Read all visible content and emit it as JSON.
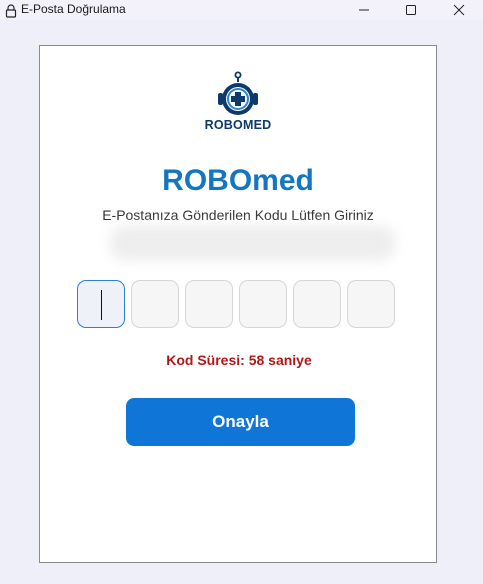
{
  "window": {
    "title": "E-Posta Doğrulama",
    "controls": [
      "minimize",
      "maximize",
      "close"
    ]
  },
  "logo": {
    "text": "ROBOMED",
    "icon": "robot-medical-cross-icon"
  },
  "app_name": "ROBOmed",
  "subtitle": "E-Postanıza Gönderilen Kodu Lütfen Giriniz",
  "code_inputs": [
    "",
    "",
    "",
    "",
    "",
    ""
  ],
  "timer_text": "Kod Süresi: 58 saniye",
  "confirm_label": "Onayla",
  "colors": {
    "accent": "#0f76d8",
    "brand_text": "#1575c0",
    "timer": "#b01818",
    "logo_navy": "#0d3a6b"
  }
}
